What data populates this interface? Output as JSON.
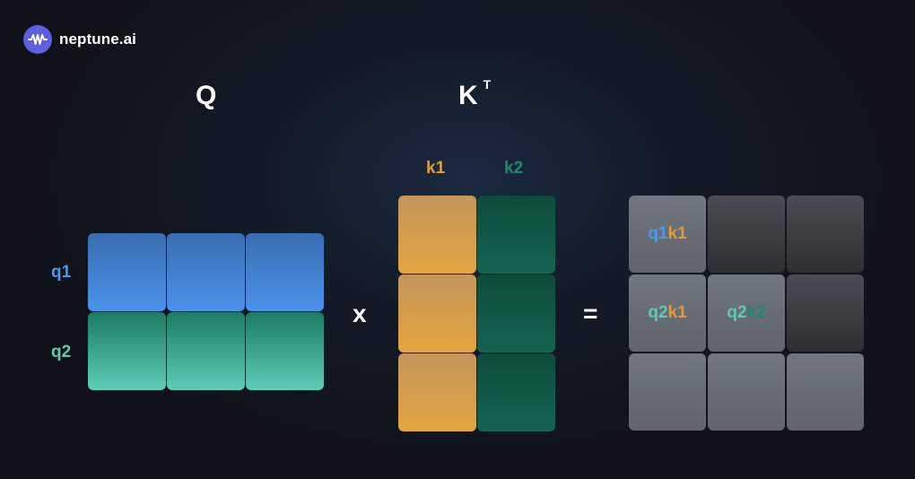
{
  "brand": {
    "name": "neptune.ai",
    "icon": "wave-icon",
    "color": "#5b5fe0"
  },
  "labels": {
    "q_matrix": "Q",
    "k_matrix": "K",
    "k_superscript": "T",
    "k_col1": "k1",
    "k_col2": "k2",
    "q_row1": "q1",
    "q_row2": "q2",
    "multiply": "x",
    "equals": "="
  },
  "result_cells": {
    "r1c1": {
      "a": "q1",
      "b": "k1"
    },
    "r2c1": {
      "a": "q2",
      "b": "k1"
    },
    "r2c2": {
      "a": "q2",
      "b": "k2"
    }
  },
  "colors": {
    "q1": "#4b99ea",
    "q2": "#5fc9b4",
    "k1": "#e09c3a",
    "k2": "#1f8a6c"
  }
}
